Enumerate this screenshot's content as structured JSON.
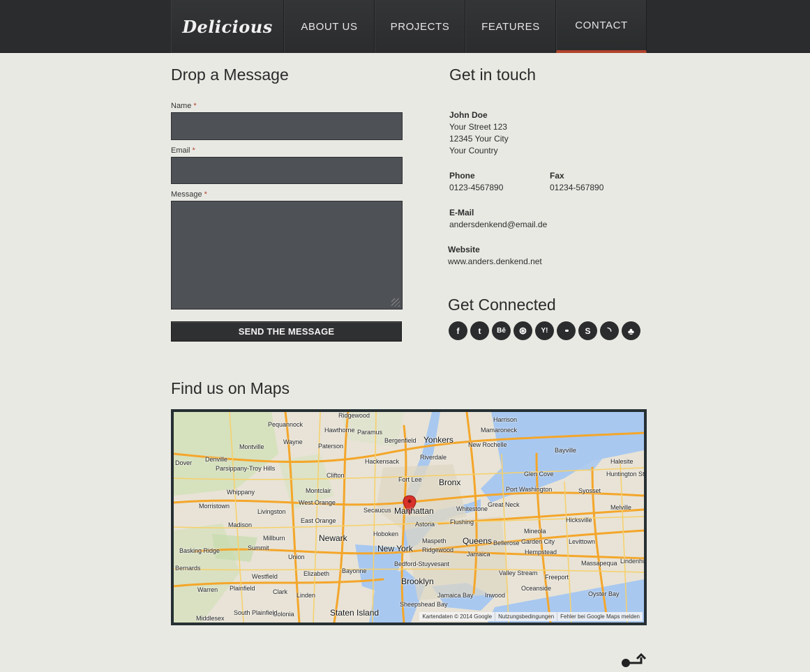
{
  "header": {
    "logo": "Delicious",
    "nav": [
      {
        "label": "ABOUT US",
        "active": false
      },
      {
        "label": "PROJECTS",
        "active": false
      },
      {
        "label": "FEATURES",
        "active": false
      },
      {
        "label": "CONTACT",
        "active": true
      }
    ],
    "accent_color": "#b0442c"
  },
  "form": {
    "title": "Drop a Message",
    "name_label": "Name",
    "email_label": "Email",
    "message_label": "Message",
    "required_mark": "*",
    "name_value": "",
    "email_value": "",
    "message_value": "",
    "submit_label": "SEND THE MESSAGE"
  },
  "contact": {
    "title": "Get in touch",
    "name": "John Doe",
    "street": "Your Street 123",
    "city": "12345 Your City",
    "country": "Your Country",
    "phone_label": "Phone",
    "phone": "0123-4567890",
    "fax_label": "Fax",
    "fax": "01234-567890",
    "email_label": "E-Mail",
    "email": "andersdenkend@email.de",
    "website_label": "Website",
    "website": "www.anders.denkend.net"
  },
  "social": {
    "title": "Get Connected",
    "icons": [
      {
        "name": "facebook-icon",
        "glyph": "f"
      },
      {
        "name": "twitter-icon",
        "glyph": "t"
      },
      {
        "name": "behance-icon",
        "glyph": "Bē"
      },
      {
        "name": "dribbble-icon",
        "glyph": "⊛"
      },
      {
        "name": "yahoo-icon",
        "glyph": "Y!"
      },
      {
        "name": "flickr-icon",
        "glyph": "••"
      },
      {
        "name": "skype-icon",
        "glyph": "S"
      },
      {
        "name": "rss-icon",
        "glyph": "◝"
      },
      {
        "name": "forrst-icon",
        "glyph": "♣"
      }
    ]
  },
  "map": {
    "title": "Find us on Maps",
    "labels": {
      "ridgewood": "Ridgewood",
      "harrison": "Harrison",
      "pequannock": "Pequannock",
      "hawthorne": "Hawthorne",
      "paramus": "Paramus",
      "mamaroneck": "Mamaroneck",
      "wayne": "Wayne",
      "paterson": "Paterson",
      "bergenfield": "Bergenfield",
      "yonkers": "Yonkers",
      "montville": "Montville",
      "newrochelle": "New Rochelle",
      "denville": "Denville",
      "riverdale": "Riverdale",
      "bayville": "Bayville",
      "dover": "Dover",
      "parsippany": "Parsippany-Troy Hills",
      "hackensack": "Hackensack",
      "halesite": "Halesite",
      "clifton": "Clifton",
      "fortlee": "Fort Lee",
      "glencove": "Glen Cove",
      "huntington": "Huntington Station",
      "bronx": "Bronx",
      "whippany": "Whippany",
      "montclair": "Montclair",
      "port": "Port Washington",
      "syosset": "Syosset",
      "morristown": "Morristown",
      "westorange": "West Orange",
      "secaucus": "Secaucus",
      "manhattan": "Manhattan",
      "whitestone": "Whitestone",
      "greatneck": "Great Neck",
      "melville": "Melville",
      "livingston": "Livingston",
      "eastorange": "East Orange",
      "astoria": "Astoria",
      "flushing": "Flushing",
      "hicksville": "Hicksville",
      "madison": "Madison",
      "hoboken": "Hoboken",
      "mineola": "Mineola",
      "millburn": "Millburn",
      "newark": "Newark",
      "maspeth": "Maspeth",
      "queens": "Queens",
      "bellerose": "Bellerose",
      "gardencity": "Garden City",
      "levittown": "Levittown",
      "summit": "Summit",
      "newyork": "New York",
      "ridgewood2": "Ridgewood",
      "basking": "Basking Ridge",
      "union": "Union",
      "hempstead": "Hempstead",
      "jamaica": "Jamaica",
      "bedford": "Bedford-Stuyvesant",
      "massapequa": "Massapequa",
      "lindenhurst": "Lindenhurst",
      "bernards": "Bernards",
      "westfield": "Westfield",
      "elizabeth": "Elizabeth",
      "bayonne": "Bayonne",
      "valleystream": "Valley Stream",
      "freeport": "Freeport",
      "brooklyn": "Brooklyn",
      "plainfield": "Plainfield",
      "clark": "Clark",
      "oceanside": "Oceanside",
      "warren": "Warren",
      "linden": "Linden",
      "jamaicabay": "Jamaica Bay",
      "inwood": "Inwood",
      "sheepshead": "Sheepshead Bay",
      "statenisland": "Staten Island",
      "colonia": "Colonia",
      "south": "South Plainfield",
      "middlesex": "Middlesex",
      "oysterbay": "Oyster Bay"
    },
    "attribution": [
      "Kartendaten © 2014 Google",
      "Nutzungsbedingungen",
      "Fehler bei Google Maps melden"
    ]
  },
  "colors": {
    "background": "#e9e9e4",
    "header": "#2b2c2d",
    "field": "#4e5155",
    "water": "#a8c8f0",
    "pin": "#d8322a"
  }
}
